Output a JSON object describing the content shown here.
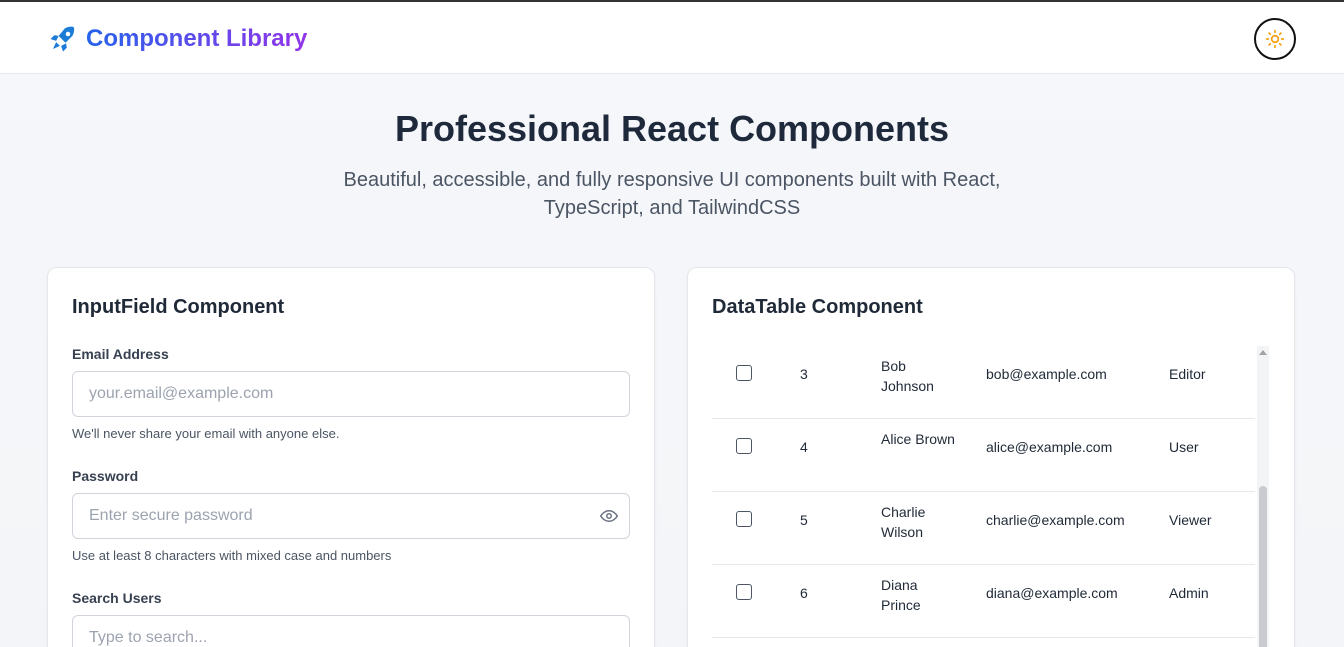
{
  "header": {
    "brand_title": "Component Library",
    "brand_icon": "rocket-icon",
    "theme_toggle_icon": "sun-icon"
  },
  "hero": {
    "title": "Professional React Components",
    "subtitle": "Beautiful, accessible, and fully responsive UI components built with React, TypeScript, and TailwindCSS"
  },
  "input_card": {
    "title": "InputField Component",
    "email": {
      "label": "Email Address",
      "placeholder": "your.email@example.com",
      "help": "We'll never share your email with anyone else."
    },
    "password": {
      "label": "Password",
      "placeholder": "Enter secure password",
      "help": "Use at least 8 characters with mixed case and numbers",
      "toggle_icon": "eye-icon"
    },
    "search": {
      "label": "Search Users",
      "placeholder": "Type to search..."
    }
  },
  "table_card": {
    "title": "DataTable Component",
    "rows": [
      {
        "id": "3",
        "name": "Bob Johnson",
        "email": "bob@example.com",
        "role": "Editor"
      },
      {
        "id": "4",
        "name": "Alice Brown",
        "email": "alice@example.com",
        "role": "User"
      },
      {
        "id": "5",
        "name": "Charlie Wilson",
        "email": "charlie@example.com",
        "role": "Viewer"
      },
      {
        "id": "6",
        "name": "Diana Prince",
        "email": "diana@example.com",
        "role": "Admin"
      }
    ]
  },
  "colors": {
    "brand_gradient_start": "#2563eb",
    "brand_gradient_end": "#9333ea",
    "sun": "#f59e0b"
  }
}
